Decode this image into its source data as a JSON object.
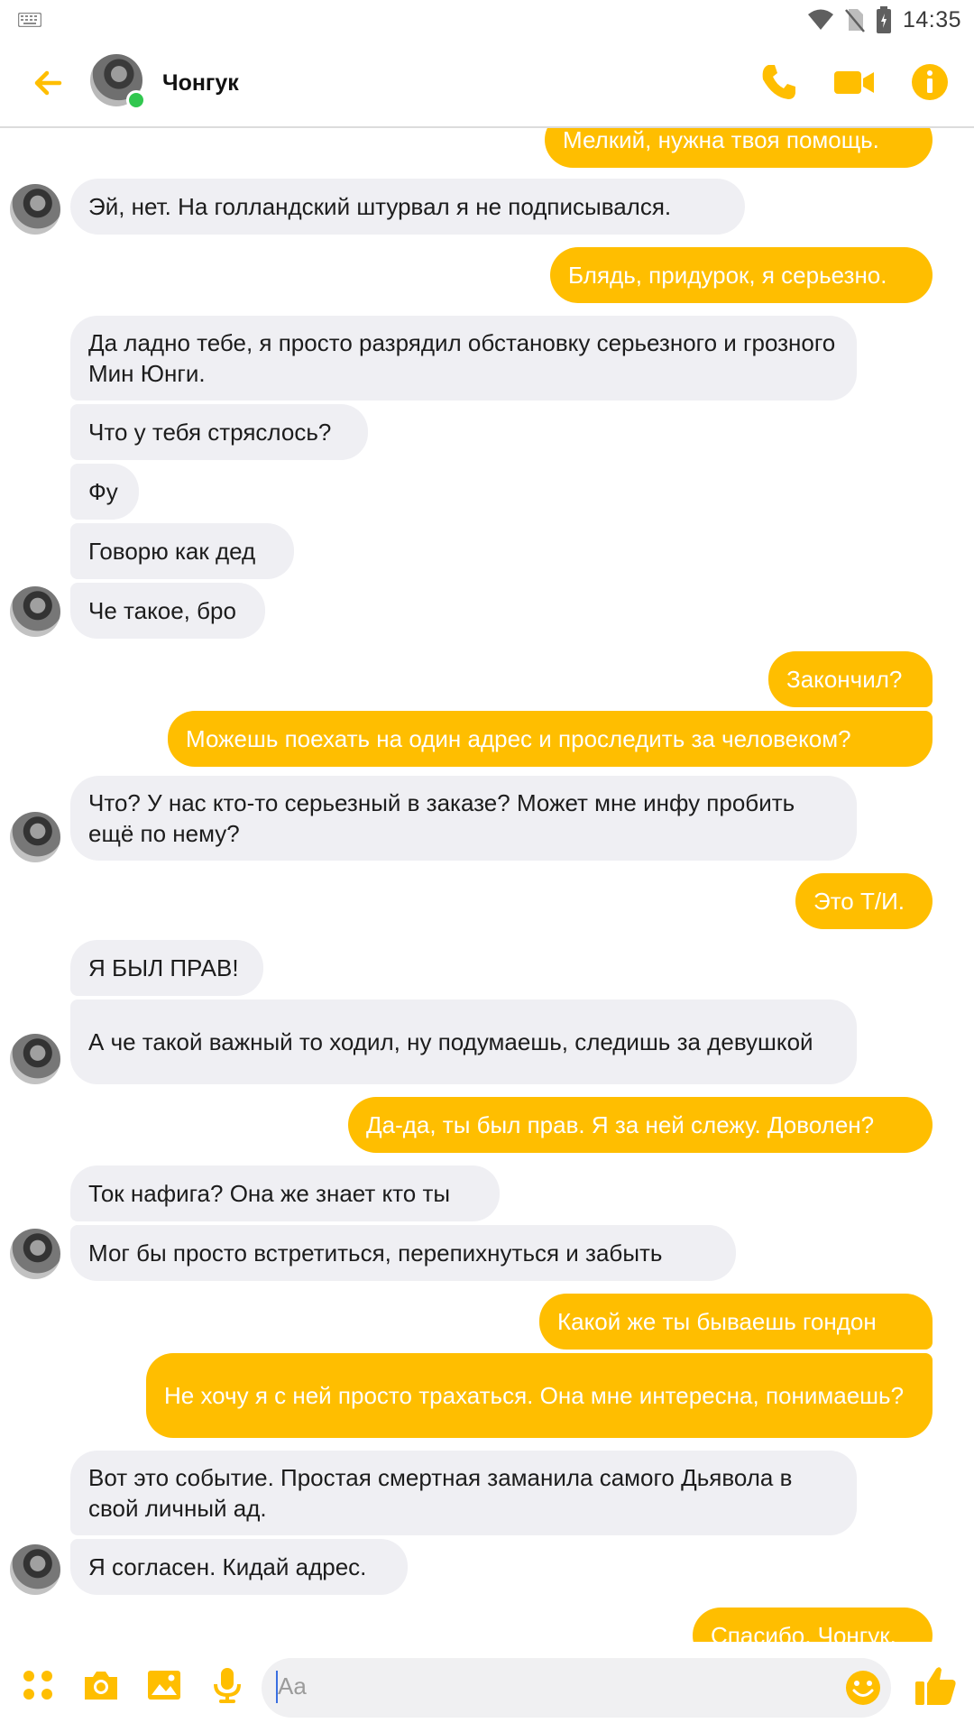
{
  "status_bar": {
    "time": "14:35"
  },
  "header": {
    "contact_name": "Чонгук"
  },
  "messages": [
    {
      "dir": "out",
      "text": "Мелкий, нужна твоя помощь."
    },
    {
      "dir": "in",
      "text": "Эй, нет. На голландский штурвал я не подписывался."
    },
    {
      "dir": "out",
      "text": "Блядь, придурок, я серьезно."
    },
    {
      "dir": "in",
      "text": "Да ладно тебе, я просто разрядил обстановку серьезного и грозного Мин Юнги."
    },
    {
      "dir": "in",
      "text": "Что у тебя стряслось?"
    },
    {
      "dir": "in",
      "text": "Фу"
    },
    {
      "dir": "in",
      "text": "Говорю как дед"
    },
    {
      "dir": "in",
      "text": "Че такое, бро"
    },
    {
      "dir": "out",
      "text": "Закончил?"
    },
    {
      "dir": "out",
      "text": "Можешь поехать на один адрес и проследить за человеком?"
    },
    {
      "dir": "in",
      "text": "Что? У нас кто-то серьезный в заказе? Может мне инфу пробить ещё по нему?"
    },
    {
      "dir": "out",
      "text": "Это Т/И."
    },
    {
      "dir": "in",
      "text": "Я БЫЛ ПРАВ!"
    },
    {
      "dir": "in",
      "text": "А че такой важный то ходил, ну подумаешь, следишь за девушкой"
    },
    {
      "dir": "out",
      "text": "Да-да, ты был прав. Я за ней слежу. Доволен?"
    },
    {
      "dir": "in",
      "text": "Ток нафига? Она же знает кто ты"
    },
    {
      "dir": "in",
      "text": "Мог бы просто встретиться, перепихнуться и забыть"
    },
    {
      "dir": "out",
      "text": "Какой же ты бываешь гондон"
    },
    {
      "dir": "out",
      "text": "Не хочу я с ней просто трахаться. Она мне интересна, понимаешь?"
    },
    {
      "dir": "in",
      "text": "Вот это событие. Простая смертная заманила самого Дьявола в свой личный ад."
    },
    {
      "dir": "in",
      "text": "Я согласен. Кидай адрес."
    },
    {
      "dir": "out",
      "text": "Спасибо, Чонгук."
    }
  ],
  "composer": {
    "placeholder": "Aa"
  },
  "colors": {
    "accent": "#ffbe00",
    "incoming_bubble": "#efeff3",
    "online": "#31c74f"
  },
  "icons": [
    "keyboard-icon",
    "wifi-icon",
    "no-sim-icon",
    "battery-icon",
    "back-arrow-icon",
    "phone-icon",
    "video-call-icon",
    "info-icon",
    "apps-icon",
    "camera-icon",
    "gallery-icon",
    "microphone-icon",
    "emoji-icon",
    "thumbs-up-icon"
  ]
}
